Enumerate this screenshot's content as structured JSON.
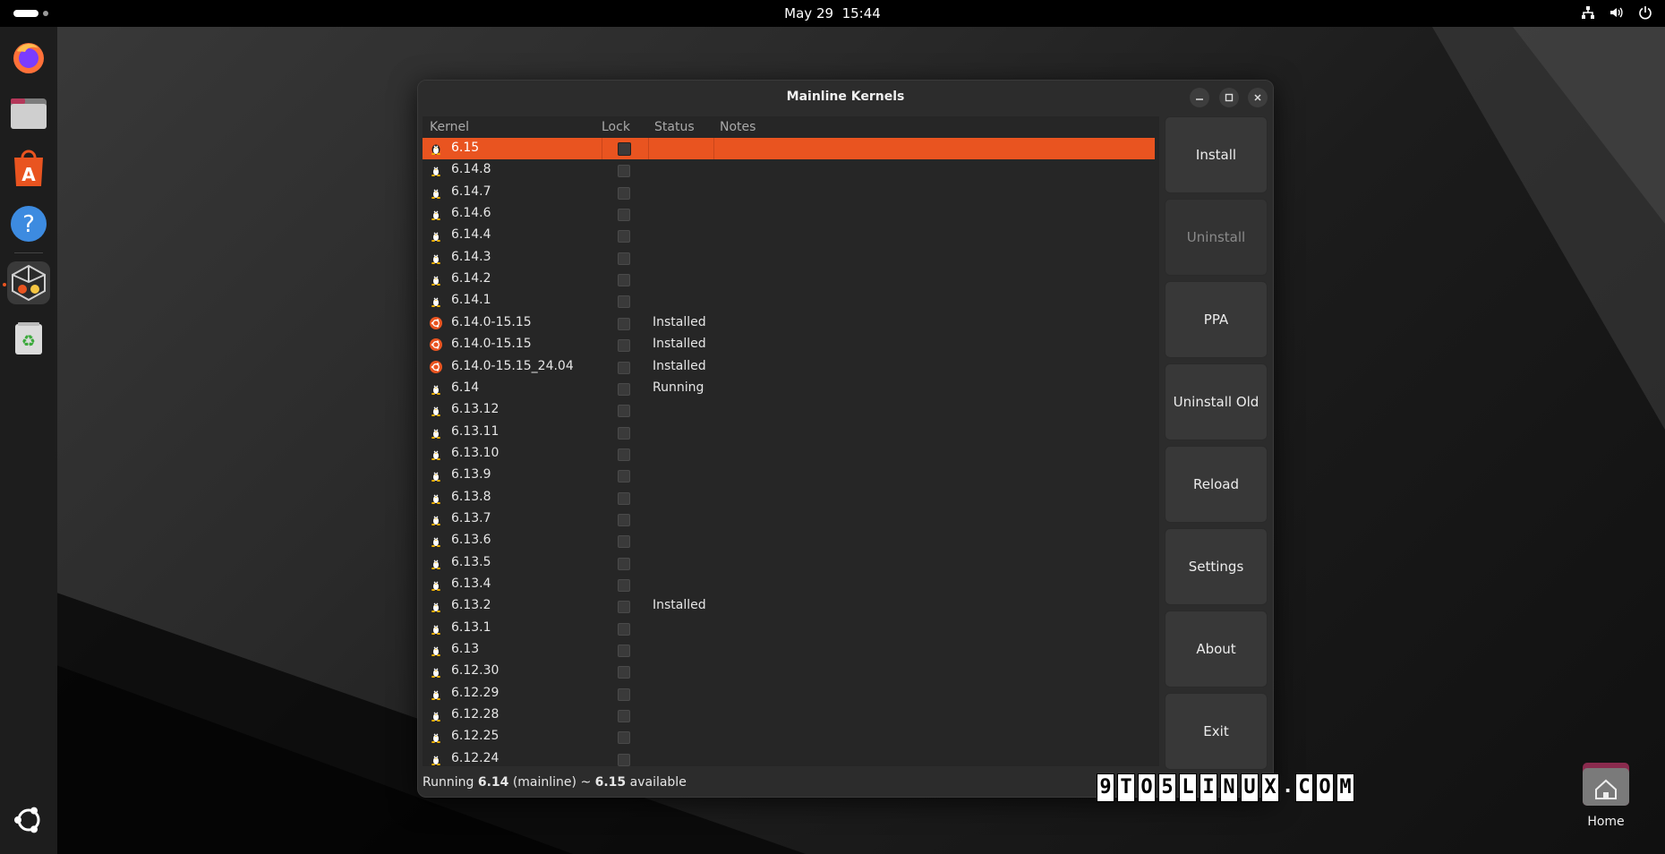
{
  "topbar": {
    "datetime": "May 29  15:44"
  },
  "dock": {
    "items": [
      {
        "name": "Firefox",
        "icon": "firefox-icon"
      },
      {
        "name": "Files",
        "icon": "files-icon"
      },
      {
        "name": "App Center",
        "icon": "app-center-icon"
      },
      {
        "name": "Help",
        "icon": "help-icon"
      },
      {
        "name": "Mainline Kernels",
        "icon": "mainline-icon"
      },
      {
        "name": "Trash",
        "icon": "trash-icon"
      }
    ],
    "apps_icon": "ubuntu-apps-icon"
  },
  "window": {
    "title": "Mainline Kernels",
    "columns": {
      "kernel": "Kernel",
      "lock": "Lock",
      "status": "Status",
      "notes": "Notes"
    },
    "rows": [
      {
        "kernel": "6.15",
        "status": "",
        "type": "mainline",
        "selected": true
      },
      {
        "kernel": "6.14.8",
        "status": "",
        "type": "mainline"
      },
      {
        "kernel": "6.14.7",
        "status": "",
        "type": "mainline"
      },
      {
        "kernel": "6.14.6",
        "status": "",
        "type": "mainline"
      },
      {
        "kernel": "6.14.4",
        "status": "",
        "type": "mainline"
      },
      {
        "kernel": "6.14.3",
        "status": "",
        "type": "mainline"
      },
      {
        "kernel": "6.14.2",
        "status": "",
        "type": "mainline"
      },
      {
        "kernel": "6.14.1",
        "status": "",
        "type": "mainline"
      },
      {
        "kernel": "6.14.0-15.15",
        "status": "Installed",
        "type": "ubuntu"
      },
      {
        "kernel": "6.14.0-15.15",
        "status": "Installed",
        "type": "ubuntu"
      },
      {
        "kernel": "6.14.0-15.15_24.04",
        "status": "Installed",
        "type": "ubuntu"
      },
      {
        "kernel": "6.14",
        "status": "Running",
        "type": "mainline"
      },
      {
        "kernel": "6.13.12",
        "status": "",
        "type": "mainline"
      },
      {
        "kernel": "6.13.11",
        "status": "",
        "type": "mainline"
      },
      {
        "kernel": "6.13.10",
        "status": "",
        "type": "mainline"
      },
      {
        "kernel": "6.13.9",
        "status": "",
        "type": "mainline"
      },
      {
        "kernel": "6.13.8",
        "status": "",
        "type": "mainline"
      },
      {
        "kernel": "6.13.7",
        "status": "",
        "type": "mainline"
      },
      {
        "kernel": "6.13.6",
        "status": "",
        "type": "mainline"
      },
      {
        "kernel": "6.13.5",
        "status": "",
        "type": "mainline"
      },
      {
        "kernel": "6.13.4",
        "status": "",
        "type": "mainline"
      },
      {
        "kernel": "6.13.2",
        "status": "Installed",
        "type": "mainline"
      },
      {
        "kernel": "6.13.1",
        "status": "",
        "type": "mainline"
      },
      {
        "kernel": "6.13",
        "status": "",
        "type": "mainline"
      },
      {
        "kernel": "6.12.30",
        "status": "",
        "type": "mainline"
      },
      {
        "kernel": "6.12.29",
        "status": "",
        "type": "mainline"
      },
      {
        "kernel": "6.12.28",
        "status": "",
        "type": "mainline"
      },
      {
        "kernel": "6.12.25",
        "status": "",
        "type": "mainline"
      },
      {
        "kernel": "6.12.24",
        "status": "",
        "type": "mainline"
      }
    ],
    "buttons": [
      {
        "label": "Install",
        "enabled": true
      },
      {
        "label": "Uninstall",
        "enabled": false
      },
      {
        "label": "PPA",
        "enabled": true
      },
      {
        "label": "Uninstall Old",
        "enabled": true
      },
      {
        "label": "Reload",
        "enabled": true
      },
      {
        "label": "Settings",
        "enabled": true
      },
      {
        "label": "About",
        "enabled": true
      },
      {
        "label": "Exit",
        "enabled": true
      }
    ],
    "statusbar": {
      "prefix": "Running ",
      "running": "6.14",
      "middle": " (mainline) ~ ",
      "available": "6.15",
      "suffix": " available"
    }
  },
  "watermark": "9TO5LINUX.COM",
  "desktop": {
    "home_label": "Home"
  },
  "colors": {
    "accent": "#e95420",
    "window_bg": "#2c2c2c",
    "topbar": "#000000"
  }
}
